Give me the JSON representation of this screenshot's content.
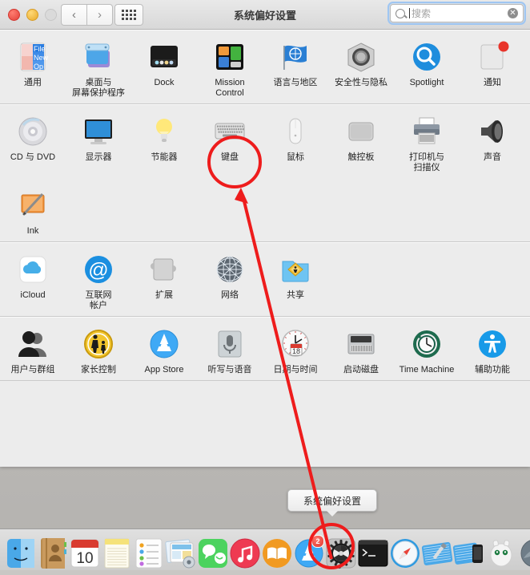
{
  "window": {
    "title": "系统偏好设置",
    "traffic_lights": [
      "close",
      "minimize",
      "zoom-disabled"
    ],
    "nav": {
      "back": "‹",
      "forward": "›"
    },
    "grid_button": "show-all-grid",
    "search": {
      "placeholder": "搜索",
      "value": "",
      "clear_label": "✕"
    }
  },
  "sections": [
    {
      "name": "personal",
      "items": [
        {
          "label": "通用",
          "icon": "general-icon"
        },
        {
          "label": "桌面与\n屏幕保护程序",
          "icon": "desktop-screensaver-icon"
        },
        {
          "label": "Dock",
          "icon": "dock-icon"
        },
        {
          "label": "Mission\nControl",
          "icon": "mission-control-icon"
        },
        {
          "label": "语言与地区",
          "icon": "language-region-icon"
        },
        {
          "label": "安全性与隐私",
          "icon": "security-privacy-icon"
        },
        {
          "label": "Spotlight",
          "icon": "spotlight-icon"
        },
        {
          "label": "通知",
          "icon": "notifications-icon"
        }
      ]
    },
    {
      "name": "hardware",
      "items": [
        {
          "label": "CD 与 DVD",
          "icon": "cd-dvd-icon"
        },
        {
          "label": "显示器",
          "icon": "displays-icon"
        },
        {
          "label": "节能器",
          "icon": "energy-saver-icon"
        },
        {
          "label": "键盘",
          "icon": "keyboard-icon"
        },
        {
          "label": "鼠标",
          "icon": "mouse-icon"
        },
        {
          "label": "触控板",
          "icon": "trackpad-icon"
        },
        {
          "label": "打印机与\n扫描仪",
          "icon": "printers-scanners-icon"
        },
        {
          "label": "声音",
          "icon": "sound-icon"
        },
        {
          "label": "Ink",
          "icon": "ink-icon"
        }
      ]
    },
    {
      "name": "internet-wireless",
      "items": [
        {
          "label": "iCloud",
          "icon": "icloud-icon"
        },
        {
          "label": "互联网\n帐户",
          "icon": "internet-accounts-icon"
        },
        {
          "label": "扩展",
          "icon": "extensions-icon"
        },
        {
          "label": "网络",
          "icon": "network-icon"
        },
        {
          "label": "共享",
          "icon": "sharing-icon"
        }
      ]
    },
    {
      "name": "system",
      "items": [
        {
          "label": "用户与群组",
          "icon": "users-groups-icon"
        },
        {
          "label": "家长控制",
          "icon": "parental-controls-icon"
        },
        {
          "label": "App Store",
          "icon": "app-store-icon"
        },
        {
          "label": "听写与语音",
          "icon": "dictation-speech-icon"
        },
        {
          "label": "日期与时间",
          "icon": "date-time-icon"
        },
        {
          "label": "启动磁盘",
          "icon": "startup-disk-icon"
        },
        {
          "label": "Time Machine",
          "icon": "time-machine-icon"
        },
        {
          "label": "辅助功能",
          "icon": "accessibility-icon"
        }
      ]
    }
  ],
  "tooltip": {
    "text": "系统偏好设置"
  },
  "dock": {
    "items": [
      {
        "name": "finder-icon",
        "running": false,
        "badge": ""
      },
      {
        "name": "contacts-icon",
        "running": false,
        "badge": ""
      },
      {
        "name": "calendar-icon",
        "running": false,
        "badge": "",
        "day": "10"
      },
      {
        "name": "notes-icon",
        "running": false,
        "badge": ""
      },
      {
        "name": "reminders-icon",
        "running": false,
        "badge": ""
      },
      {
        "name": "system-prefs-dock-stack-icon",
        "running": false,
        "badge": ""
      },
      {
        "name": "messages-icon",
        "running": false,
        "badge": ""
      },
      {
        "name": "itunes-icon",
        "running": false,
        "badge": ""
      },
      {
        "name": "ibooks-icon",
        "running": false,
        "badge": ""
      },
      {
        "name": "app-store-dock-icon",
        "running": false,
        "badge": "2"
      },
      {
        "name": "system-preferences-dock-icon",
        "running": true,
        "badge": ""
      },
      {
        "name": "terminal-icon",
        "running": false,
        "badge": ""
      },
      {
        "name": "safari-icon",
        "running": false,
        "badge": ""
      },
      {
        "name": "xcode-icon",
        "running": false,
        "badge": ""
      },
      {
        "name": "simulator-icon",
        "running": false,
        "badge": ""
      },
      {
        "name": "sourcetree-icon",
        "running": false,
        "badge": ""
      },
      {
        "name": "preview-icon",
        "running": false,
        "badge": ""
      }
    ]
  },
  "annotations": {
    "color": "#ee1c1c",
    "highlight_circle_target": "键盘",
    "dock_circle_target": "系统偏好设置",
    "arrow": {
      "from": "dock-system-preferences",
      "to": "keyboard-pref-pane"
    }
  }
}
